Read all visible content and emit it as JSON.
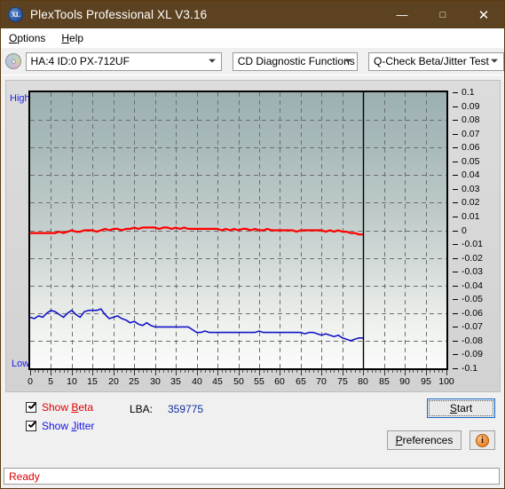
{
  "window": {
    "title": "PlexTools Professional XL V3.16",
    "app_icon": "disc-xl-icon",
    "minimize": "—",
    "maximize": "□",
    "close": "✕",
    "titlebar_color": "#5c4220"
  },
  "menu": {
    "items": [
      {
        "label": "Options",
        "accel": "O"
      },
      {
        "label": "Help",
        "accel": "H"
      }
    ]
  },
  "toolbar": {
    "drive_select": "HA:4 ID:0  PX-712UF",
    "function_select": "CD Diagnostic Functions",
    "test_select": "Q-Check Beta/Jitter Test"
  },
  "graph": {
    "top_label": "High",
    "bottom_label": "Low"
  },
  "controls": {
    "show_beta_label": "Show Beta",
    "show_beta_checked": true,
    "show_beta_color": "#e00000",
    "show_jitter_label": "Show Jitter",
    "show_jitter_checked": true,
    "show_jitter_color": "#1414e6",
    "lba_label": "LBA:",
    "lba_value": "359775",
    "start_label": "Start",
    "preferences_label": "Preferences",
    "info_label": "i"
  },
  "statusbar": {
    "text": "Ready",
    "color": "#e00000"
  },
  "chart_data": {
    "type": "line",
    "title": "Q-Check Beta/Jitter Test",
    "xlabel": "",
    "ylabel": "",
    "xlim": [
      0,
      100
    ],
    "ylim": [
      -0.1,
      0.1
    ],
    "xticks": [
      0,
      5,
      10,
      15,
      20,
      25,
      30,
      35,
      40,
      45,
      50,
      55,
      60,
      65,
      70,
      75,
      80,
      85,
      90,
      95,
      100
    ],
    "yticks": [
      0.1,
      0.09,
      0.08,
      0.07,
      0.06,
      0.05,
      0.04,
      0.03,
      0.02,
      0.01,
      0,
      -0.01,
      -0.02,
      -0.03,
      -0.04,
      -0.05,
      -0.06,
      -0.07,
      -0.08,
      -0.09,
      -0.1
    ],
    "ytick_labels": [
      "0.1",
      "0.09",
      "0.08",
      "0.07",
      "0.06",
      "0.05",
      "0.04",
      "0.03",
      "0.02",
      "0.01",
      "0",
      "-0.01",
      "-0.02",
      "-0.03",
      "-0.04",
      "-0.05",
      "-0.06",
      "-0.07",
      "-0.08",
      "-0.09",
      "-0.1"
    ],
    "grid": true,
    "grid_style": "dashed",
    "legend": "checkbox-toggles",
    "data_end_marker_x": 80,
    "series": [
      {
        "name": "Beta",
        "color": "#ff0000",
        "x": [
          0,
          1,
          2,
          3,
          4,
          5,
          6,
          7,
          8,
          9,
          10,
          11,
          12,
          13,
          14,
          15,
          16,
          17,
          18,
          19,
          20,
          21,
          22,
          23,
          24,
          25,
          26,
          27,
          28,
          29,
          30,
          31,
          32,
          33,
          34,
          35,
          36,
          37,
          38,
          39,
          40,
          41,
          42,
          43,
          44,
          45,
          46,
          47,
          48,
          49,
          50,
          51,
          52,
          53,
          54,
          55,
          56,
          57,
          58,
          59,
          60,
          61,
          62,
          63,
          64,
          65,
          66,
          67,
          68,
          69,
          70,
          71,
          72,
          73,
          74,
          75,
          76,
          77,
          78,
          79,
          80
        ],
        "y": [
          -0.002,
          -0.002,
          -0.002,
          -0.002,
          -0.002,
          -0.002,
          -0.002,
          -0.001,
          -0.002,
          -0.001,
          0.0,
          -0.001,
          -0.001,
          0.0,
          0.0,
          0.0,
          -0.001,
          0.0,
          0.001,
          0.0,
          0.001,
          0.001,
          0.0,
          0.001,
          0.001,
          0.002,
          0.001,
          0.002,
          0.002,
          0.002,
          0.002,
          0.001,
          0.002,
          0.002,
          0.001,
          0.002,
          0.001,
          0.002,
          0.001,
          0.001,
          0.001,
          0.001,
          0.001,
          0.001,
          0.001,
          0.001,
          0.0,
          0.001,
          0.0,
          0.001,
          0.0,
          0.001,
          0.001,
          0.0,
          0.001,
          0.0,
          0.0,
          0.001,
          0.0,
          0.0,
          0.0,
          0.0,
          0.0,
          0.0,
          -0.001,
          0.0,
          0.0,
          0.0,
          0.0,
          0.0,
          0.0,
          -0.001,
          0.0,
          -0.001,
          0.0,
          -0.001,
          -0.001,
          -0.002,
          -0.002,
          -0.003,
          -0.003
        ]
      },
      {
        "name": "Jitter",
        "color": "#1414c8",
        "x": [
          0,
          1,
          2,
          3,
          4,
          5,
          6,
          7,
          8,
          9,
          10,
          11,
          12,
          13,
          14,
          15,
          16,
          17,
          18,
          19,
          20,
          21,
          22,
          23,
          24,
          25,
          26,
          27,
          28,
          29,
          30,
          31,
          32,
          33,
          34,
          35,
          36,
          37,
          38,
          39,
          40,
          41,
          42,
          43,
          44,
          45,
          46,
          47,
          48,
          49,
          50,
          51,
          52,
          53,
          54,
          55,
          56,
          57,
          58,
          59,
          60,
          61,
          62,
          63,
          64,
          65,
          66,
          67,
          68,
          69,
          70,
          71,
          72,
          73,
          74,
          75,
          76,
          77,
          78,
          79,
          80
        ],
        "y": [
          -0.063,
          -0.064,
          -0.062,
          -0.063,
          -0.06,
          -0.058,
          -0.059,
          -0.061,
          -0.063,
          -0.06,
          -0.058,
          -0.061,
          -0.063,
          -0.059,
          -0.058,
          -0.058,
          -0.058,
          -0.057,
          -0.061,
          -0.064,
          -0.063,
          -0.062,
          -0.064,
          -0.065,
          -0.067,
          -0.066,
          -0.068,
          -0.069,
          -0.067,
          -0.069,
          -0.07,
          -0.07,
          -0.07,
          -0.07,
          -0.07,
          -0.07,
          -0.07,
          -0.07,
          -0.07,
          -0.072,
          -0.074,
          -0.074,
          -0.073,
          -0.074,
          -0.074,
          -0.074,
          -0.074,
          -0.074,
          -0.074,
          -0.074,
          -0.074,
          -0.074,
          -0.074,
          -0.074,
          -0.074,
          -0.073,
          -0.074,
          -0.074,
          -0.074,
          -0.074,
          -0.074,
          -0.074,
          -0.074,
          -0.074,
          -0.074,
          -0.074,
          -0.075,
          -0.074,
          -0.074,
          -0.075,
          -0.076,
          -0.075,
          -0.076,
          -0.077,
          -0.076,
          -0.078,
          -0.079,
          -0.08,
          -0.079,
          -0.078,
          -0.078
        ]
      }
    ]
  }
}
